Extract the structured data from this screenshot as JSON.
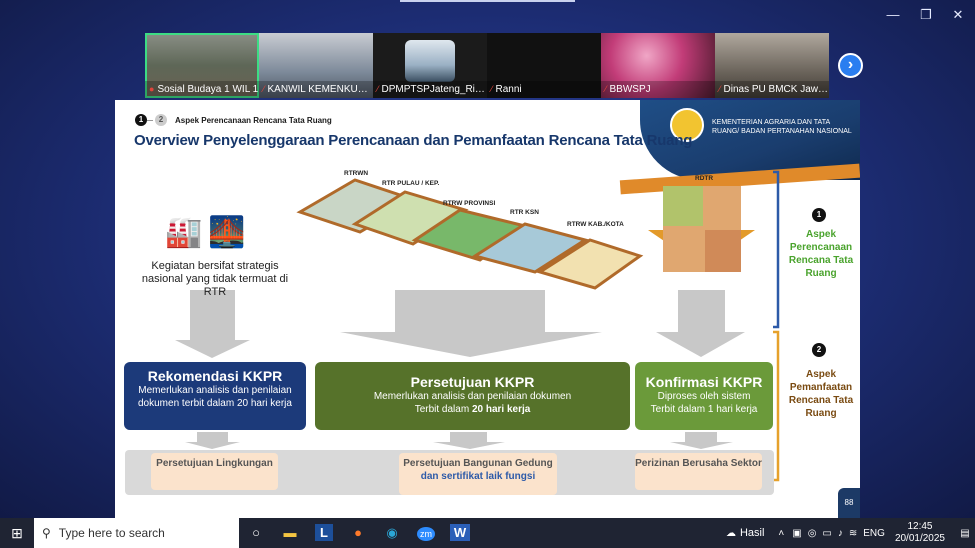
{
  "window": {
    "minimize": "—",
    "restore": "❐",
    "close": "✕"
  },
  "participants": [
    {
      "name": "Sosial Budaya 1 WIL 1",
      "active": true
    },
    {
      "name": "KANWIL KEMENKUM...",
      "active": false
    },
    {
      "name": "DPMPTSPJateng_Rizal",
      "active": false
    },
    {
      "name": "Ranni",
      "active": false
    },
    {
      "name": "BBWSPJ",
      "active": false
    },
    {
      "name": "Dinas PU BMCK Jawa...",
      "active": false
    }
  ],
  "next_button": "›",
  "slide": {
    "step_dot_1": "1",
    "step_dot_2": "2",
    "step_label": "Aspek Perencanaan Rencana Tata Ruang",
    "title": "Overview Penyelenggaraan Perencanaan dan Pemanfaatan Rencana Tata Ruang",
    "ministry": "KEMENTERIAN AGRARIA DAN TATA RUANG/ BADAN PERTANAHAN NASIONAL",
    "kegiatan": "Kegiatan bersifat strategis nasional yang tidak termuat di RTR",
    "map_labels": {
      "rtrwn": "RTRWN",
      "rtr_pulau": "RTR PULAU / KEP.",
      "rtrw_provinsi": "RTRW PROVINSI",
      "rtr_ksn": "RTR KSN",
      "rtrw_kab": "RTRW KAB./KOTA",
      "rdtr": "RDTR"
    },
    "aspect1": {
      "num": "1",
      "text": "Aspek Perencanaan Rencana Tata Ruang"
    },
    "aspect2": {
      "num": "2",
      "text": "Aspek Pemanfaatan Rencana Tata Ruang"
    },
    "boxes": {
      "rekomendasi": {
        "title": "Rekomendasi KKPR",
        "text": "Memerlukan analisis dan penilaian dokumen terbit dalam 20 hari kerja"
      },
      "persetujuan": {
        "title": "Persetujuan KKPR",
        "line1": "Memerlukan analisis dan penilaian dokumen",
        "line2_pre": "Terbit dalam ",
        "line2_bold": "20 hari kerja"
      },
      "konfirmasi": {
        "title": "Konfirmasi KKPR",
        "line1": "Diproses oleh sistem",
        "line2": "Terbit dalam 1 hari kerja"
      }
    },
    "subs": {
      "lingkungan": "Persetujuan Lingkungan",
      "pbg1": "Persetujuan Bangunan Gedung",
      "pbg2": "dan sertifikat laik fungsi",
      "perizinan": "Perizinan Berusaha Sektor"
    },
    "page_number": "88"
  },
  "taskbar": {
    "search_placeholder": "Type here to search",
    "weather": "Hasil",
    "language": "ENG",
    "time": "12:45",
    "date": "20/01/2025"
  },
  "colors": {
    "navy": "#17376b",
    "olive": "#5a7a2a",
    "green": "#6b9a3a",
    "orange": "#e08a2a"
  }
}
